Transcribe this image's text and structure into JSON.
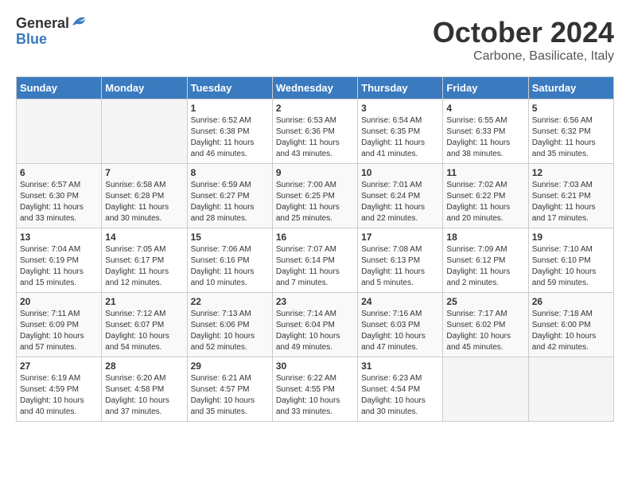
{
  "header": {
    "logo_general": "General",
    "logo_blue": "Blue",
    "month": "October 2024",
    "location": "Carbone, Basilicate, Italy"
  },
  "weekdays": [
    "Sunday",
    "Monday",
    "Tuesday",
    "Wednesday",
    "Thursday",
    "Friday",
    "Saturday"
  ],
  "weeks": [
    [
      {
        "day": "",
        "sunrise": "",
        "sunset": "",
        "daylight": ""
      },
      {
        "day": "",
        "sunrise": "",
        "sunset": "",
        "daylight": ""
      },
      {
        "day": "1",
        "sunrise": "Sunrise: 6:52 AM",
        "sunset": "Sunset: 6:38 PM",
        "daylight": "Daylight: 11 hours and 46 minutes."
      },
      {
        "day": "2",
        "sunrise": "Sunrise: 6:53 AM",
        "sunset": "Sunset: 6:36 PM",
        "daylight": "Daylight: 11 hours and 43 minutes."
      },
      {
        "day": "3",
        "sunrise": "Sunrise: 6:54 AM",
        "sunset": "Sunset: 6:35 PM",
        "daylight": "Daylight: 11 hours and 41 minutes."
      },
      {
        "day": "4",
        "sunrise": "Sunrise: 6:55 AM",
        "sunset": "Sunset: 6:33 PM",
        "daylight": "Daylight: 11 hours and 38 minutes."
      },
      {
        "day": "5",
        "sunrise": "Sunrise: 6:56 AM",
        "sunset": "Sunset: 6:32 PM",
        "daylight": "Daylight: 11 hours and 35 minutes."
      }
    ],
    [
      {
        "day": "6",
        "sunrise": "Sunrise: 6:57 AM",
        "sunset": "Sunset: 6:30 PM",
        "daylight": "Daylight: 11 hours and 33 minutes."
      },
      {
        "day": "7",
        "sunrise": "Sunrise: 6:58 AM",
        "sunset": "Sunset: 6:28 PM",
        "daylight": "Daylight: 11 hours and 30 minutes."
      },
      {
        "day": "8",
        "sunrise": "Sunrise: 6:59 AM",
        "sunset": "Sunset: 6:27 PM",
        "daylight": "Daylight: 11 hours and 28 minutes."
      },
      {
        "day": "9",
        "sunrise": "Sunrise: 7:00 AM",
        "sunset": "Sunset: 6:25 PM",
        "daylight": "Daylight: 11 hours and 25 minutes."
      },
      {
        "day": "10",
        "sunrise": "Sunrise: 7:01 AM",
        "sunset": "Sunset: 6:24 PM",
        "daylight": "Daylight: 11 hours and 22 minutes."
      },
      {
        "day": "11",
        "sunrise": "Sunrise: 7:02 AM",
        "sunset": "Sunset: 6:22 PM",
        "daylight": "Daylight: 11 hours and 20 minutes."
      },
      {
        "day": "12",
        "sunrise": "Sunrise: 7:03 AM",
        "sunset": "Sunset: 6:21 PM",
        "daylight": "Daylight: 11 hours and 17 minutes."
      }
    ],
    [
      {
        "day": "13",
        "sunrise": "Sunrise: 7:04 AM",
        "sunset": "Sunset: 6:19 PM",
        "daylight": "Daylight: 11 hours and 15 minutes."
      },
      {
        "day": "14",
        "sunrise": "Sunrise: 7:05 AM",
        "sunset": "Sunset: 6:17 PM",
        "daylight": "Daylight: 11 hours and 12 minutes."
      },
      {
        "day": "15",
        "sunrise": "Sunrise: 7:06 AM",
        "sunset": "Sunset: 6:16 PM",
        "daylight": "Daylight: 11 hours and 10 minutes."
      },
      {
        "day": "16",
        "sunrise": "Sunrise: 7:07 AM",
        "sunset": "Sunset: 6:14 PM",
        "daylight": "Daylight: 11 hours and 7 minutes."
      },
      {
        "day": "17",
        "sunrise": "Sunrise: 7:08 AM",
        "sunset": "Sunset: 6:13 PM",
        "daylight": "Daylight: 11 hours and 5 minutes."
      },
      {
        "day": "18",
        "sunrise": "Sunrise: 7:09 AM",
        "sunset": "Sunset: 6:12 PM",
        "daylight": "Daylight: 11 hours and 2 minutes."
      },
      {
        "day": "19",
        "sunrise": "Sunrise: 7:10 AM",
        "sunset": "Sunset: 6:10 PM",
        "daylight": "Daylight: 10 hours and 59 minutes."
      }
    ],
    [
      {
        "day": "20",
        "sunrise": "Sunrise: 7:11 AM",
        "sunset": "Sunset: 6:09 PM",
        "daylight": "Daylight: 10 hours and 57 minutes."
      },
      {
        "day": "21",
        "sunrise": "Sunrise: 7:12 AM",
        "sunset": "Sunset: 6:07 PM",
        "daylight": "Daylight: 10 hours and 54 minutes."
      },
      {
        "day": "22",
        "sunrise": "Sunrise: 7:13 AM",
        "sunset": "Sunset: 6:06 PM",
        "daylight": "Daylight: 10 hours and 52 minutes."
      },
      {
        "day": "23",
        "sunrise": "Sunrise: 7:14 AM",
        "sunset": "Sunset: 6:04 PM",
        "daylight": "Daylight: 10 hours and 49 minutes."
      },
      {
        "day": "24",
        "sunrise": "Sunrise: 7:16 AM",
        "sunset": "Sunset: 6:03 PM",
        "daylight": "Daylight: 10 hours and 47 minutes."
      },
      {
        "day": "25",
        "sunrise": "Sunrise: 7:17 AM",
        "sunset": "Sunset: 6:02 PM",
        "daylight": "Daylight: 10 hours and 45 minutes."
      },
      {
        "day": "26",
        "sunrise": "Sunrise: 7:18 AM",
        "sunset": "Sunset: 6:00 PM",
        "daylight": "Daylight: 10 hours and 42 minutes."
      }
    ],
    [
      {
        "day": "27",
        "sunrise": "Sunrise: 6:19 AM",
        "sunset": "Sunset: 4:59 PM",
        "daylight": "Daylight: 10 hours and 40 minutes."
      },
      {
        "day": "28",
        "sunrise": "Sunrise: 6:20 AM",
        "sunset": "Sunset: 4:58 PM",
        "daylight": "Daylight: 10 hours and 37 minutes."
      },
      {
        "day": "29",
        "sunrise": "Sunrise: 6:21 AM",
        "sunset": "Sunset: 4:57 PM",
        "daylight": "Daylight: 10 hours and 35 minutes."
      },
      {
        "day": "30",
        "sunrise": "Sunrise: 6:22 AM",
        "sunset": "Sunset: 4:55 PM",
        "daylight": "Daylight: 10 hours and 33 minutes."
      },
      {
        "day": "31",
        "sunrise": "Sunrise: 6:23 AM",
        "sunset": "Sunset: 4:54 PM",
        "daylight": "Daylight: 10 hours and 30 minutes."
      },
      {
        "day": "",
        "sunrise": "",
        "sunset": "",
        "daylight": ""
      },
      {
        "day": "",
        "sunrise": "",
        "sunset": "",
        "daylight": ""
      }
    ]
  ]
}
